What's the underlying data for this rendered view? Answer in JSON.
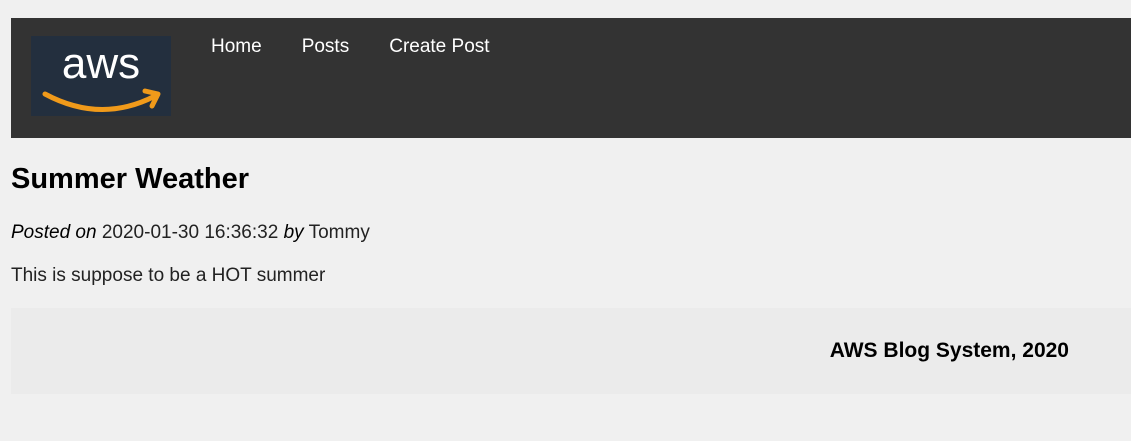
{
  "header": {
    "logo_text": "aws",
    "nav": [
      {
        "label": "Home"
      },
      {
        "label": "Posts"
      },
      {
        "label": "Create Post"
      }
    ]
  },
  "post": {
    "title": "Summer Weather",
    "posted_on_label": "Posted on",
    "date": "2020-01-30 16:36:32",
    "by_label": "by",
    "author": "Tommy",
    "body": "This is suppose to be a HOT summer"
  },
  "footer": {
    "text": "AWS Blog System, 2020"
  },
  "colors": {
    "header_bg": "#333333",
    "logo_bg": "#232f3e",
    "logo_smile": "#f09a1a",
    "page_bg": "#f0f0f0",
    "footer_bg": "#ebebeb"
  }
}
